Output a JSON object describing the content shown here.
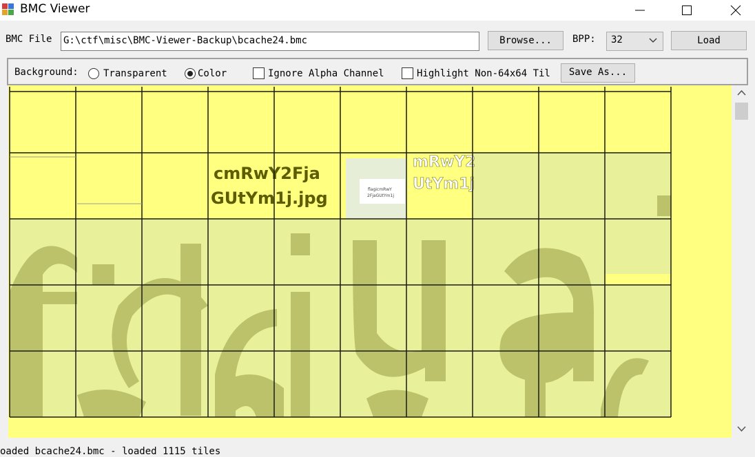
{
  "window": {
    "title": "BMC Viewer"
  },
  "toolbar": {
    "file_label": "BMC File",
    "file_path": "G:\\ctf\\misc\\BMC-Viewer-Backup\\bcache24.bmc",
    "browse_label": "Browse...",
    "bpp_label": "BPP:",
    "bpp_value": "32",
    "load_label": "Load"
  },
  "options": {
    "background_label": "Background:",
    "transparent_label": "Transparent",
    "transparent_checked": false,
    "color_label": "Color",
    "color_checked": true,
    "ignore_alpha_label": "Ignore Alpha Channel",
    "ignore_alpha_checked": false,
    "highlight_label": "Highlight Non-64x64 Til",
    "highlight_checked": false,
    "save_as_label": "Save As..."
  },
  "canvas": {
    "background_color": "#ffff80",
    "tile_color": "#e8f09a",
    "glyph_color": "#bcc26a",
    "tile_text_line1": "cmRwY2Fja",
    "tile_text_line2": "GUtYm1j.jpg",
    "tile_fragment_line1": "mRwY2",
    "tile_fragment_line2": "UtYm1j",
    "thumb_line1": "flagicmRwY",
    "thumb_line2": "2FjaGUtYm1j",
    "grid_columns": 10,
    "grid_rows": 5
  },
  "status": {
    "text": "oaded bcache24.bmc - loaded 1115 tiles"
  }
}
